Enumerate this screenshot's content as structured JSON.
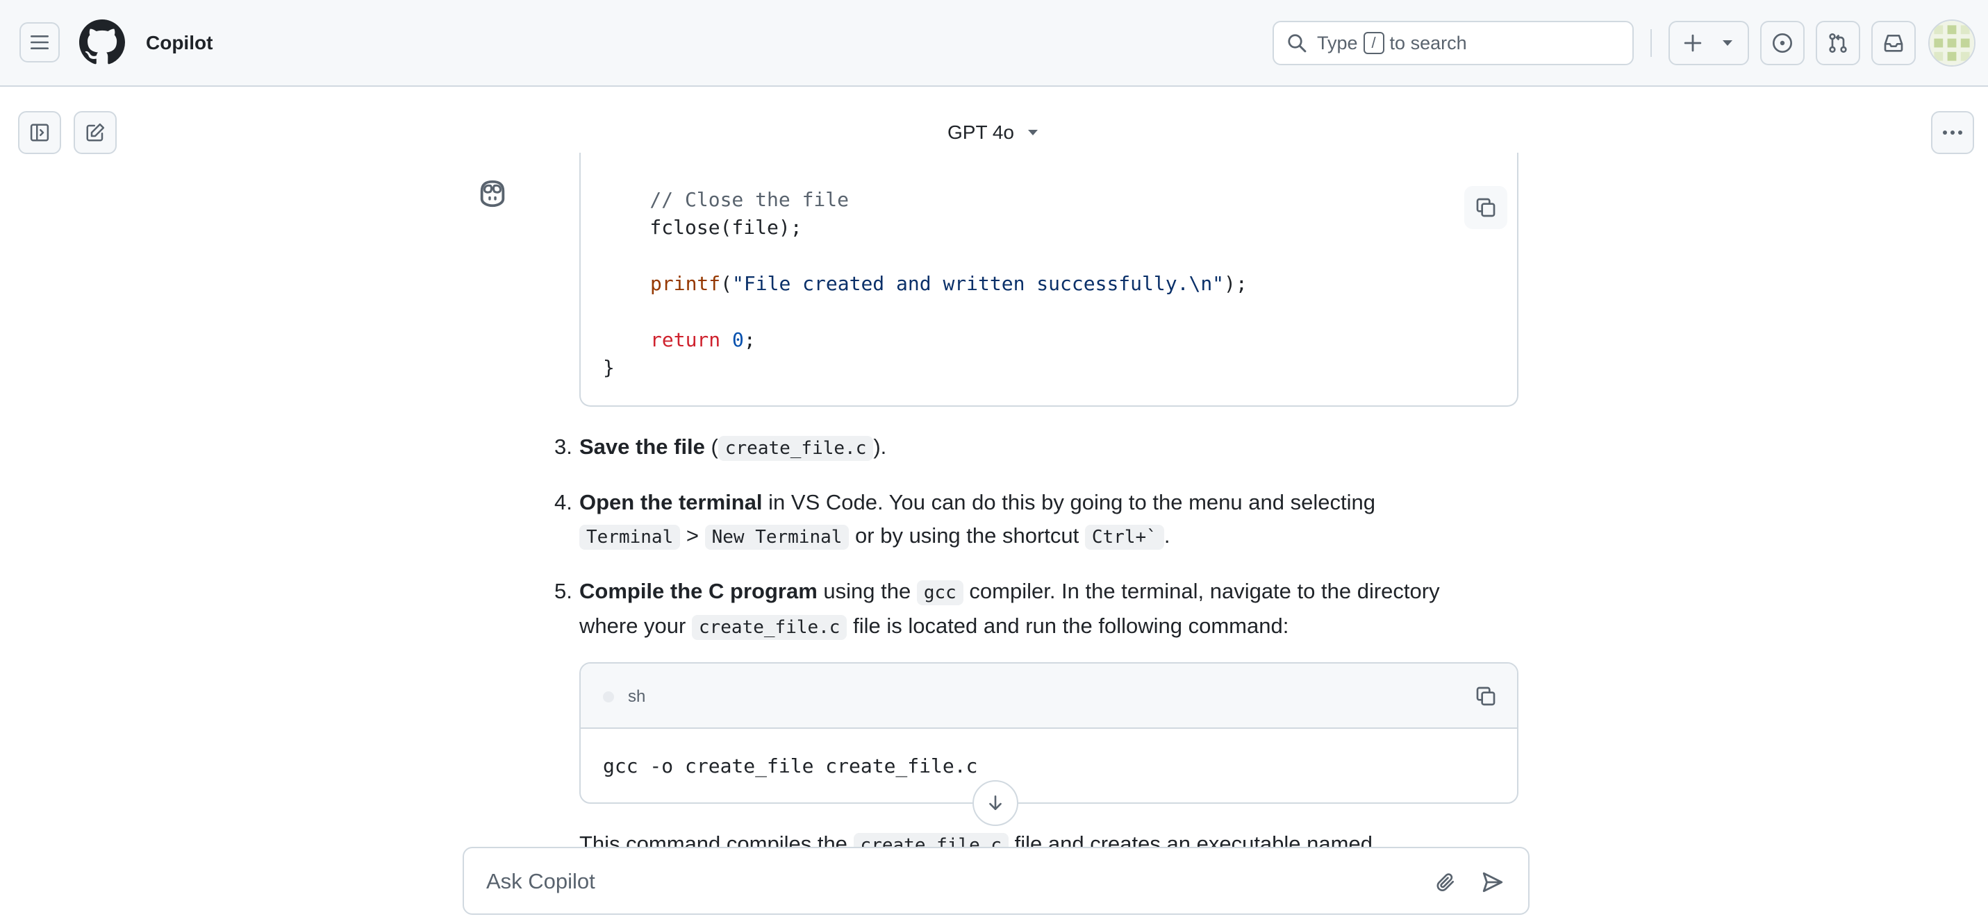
{
  "header": {
    "app_title": "Copilot",
    "search_prefix": "Type",
    "search_key": "/",
    "search_suffix": "to search",
    "icons": [
      "menu-icon",
      "github-logo-icon",
      "search-icon",
      "plus-icon",
      "triangle-down-icon",
      "issue-opened-icon",
      "git-pull-request-icon",
      "inbox-icon"
    ]
  },
  "subheader": {
    "model": "GPT 4o",
    "icons": [
      "sidebar-expand-icon",
      "pencil-icon",
      "kebab-horizontal-icon"
    ]
  },
  "conversation": {
    "code_block_1": {
      "lines": {
        "comment": "    // Close the file",
        "fclose": "    fclose(file);",
        "printf_func": "printf",
        "printf_open": "(",
        "printf_str": "\"File created and written successfully.\\n\"",
        "printf_close": ");",
        "return_kw": "return",
        "return_num": "0",
        "return_end": ";",
        "brace": "}"
      }
    },
    "steps": [
      {
        "number": "3.",
        "bold": "Save the file",
        "pre": " (",
        "code": "create_file.c",
        "post": ")."
      },
      {
        "number": "4.",
        "bold": "Open the terminal",
        "text1": " in VS Code. You can do this by going to the menu and selecting",
        "code1": "Terminal",
        "sep": " > ",
        "code2": "New Terminal",
        "text2": " or by using the shortcut ",
        "code3": "Ctrl+`",
        "post": "."
      },
      {
        "number": "5.",
        "bold": "Compile the C program",
        "text1": " using the ",
        "code1": "gcc",
        "text2": " compiler. In the terminal, navigate to the directory",
        "text3": "where your ",
        "code2": "create_file.c",
        "text4": " file is located and run the following command:"
      }
    ],
    "code_block_2": {
      "language": "sh",
      "code": "gcc -o create_file create_file.c"
    },
    "clipped_text": {
      "pre": "This command compiles the ",
      "code": "create_file.c",
      "post": " file and creates an executable named"
    }
  },
  "composer": {
    "placeholder": "Ask Copilot"
  },
  "colors": {
    "border": "#d1d9e0",
    "header_bg": "#f6f8fa",
    "comment": "#59636e",
    "function": "#953800",
    "string": "#0a3069",
    "keyword": "#cf222e",
    "number": "#0550ae"
  }
}
